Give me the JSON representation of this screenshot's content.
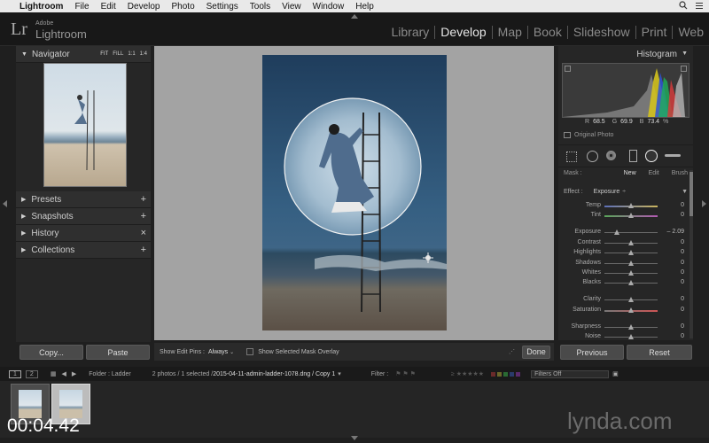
{
  "menubar": {
    "items": [
      "Lightroom",
      "File",
      "Edit",
      "Develop",
      "Photo",
      "Settings",
      "Tools",
      "View",
      "Window",
      "Help"
    ]
  },
  "identity": {
    "adobe": "Adobe",
    "app": "Lightroom",
    "logo": "Lr"
  },
  "modules": [
    "Library",
    "Develop",
    "Map",
    "Book",
    "Slideshow",
    "Print",
    "Web"
  ],
  "navigator": {
    "title": "Navigator",
    "zoom": [
      "FIT",
      "FILL",
      "1:1",
      "1:4"
    ]
  },
  "left_panels": [
    {
      "label": "Presets",
      "action": "+"
    },
    {
      "label": "Snapshots",
      "action": "+"
    },
    {
      "label": "History",
      "action": "×"
    },
    {
      "label": "Collections",
      "action": "+"
    }
  ],
  "left_buttons": {
    "copy": "Copy...",
    "paste": "Paste"
  },
  "toolbar": {
    "edit_pins_label": "Show Edit Pins :",
    "edit_pins_value": "Always",
    "mask_overlay": "Show Selected Mask Overlay",
    "done": "Done"
  },
  "histogram": {
    "title": "Histogram",
    "r_label": "R",
    "r_value": "68.5",
    "g_label": "G",
    "g_value": "69.9",
    "b_label": "B",
    "b_value": "73.4",
    "percent": "%",
    "original": "Original Photo"
  },
  "mask": {
    "label": "Mask :",
    "new": "New",
    "edit": "Edit",
    "brush": "Brush"
  },
  "effect": {
    "label": "Effect :",
    "value": "Exposure"
  },
  "adjustments": [
    {
      "label": "Temp",
      "value": "0",
      "pos": 0.5
    },
    {
      "label": "Tint",
      "value": "0",
      "pos": 0.5
    },
    {
      "label": "Exposure",
      "value": "– 2.09",
      "pos": 0.24
    },
    {
      "label": "Contrast",
      "value": "0",
      "pos": 0.5
    },
    {
      "label": "Highlights",
      "value": "0",
      "pos": 0.5
    },
    {
      "label": "Shadows",
      "value": "0",
      "pos": 0.5
    },
    {
      "label": "Whites",
      "value": "0",
      "pos": 0.5
    },
    {
      "label": "Blacks",
      "value": "0",
      "pos": 0.5
    },
    {
      "label": "Clarity",
      "value": "0",
      "pos": 0.5
    },
    {
      "label": "Saturation",
      "value": "0",
      "pos": 0.5
    },
    {
      "label": "Sharpness",
      "value": "0",
      "pos": 0.5
    },
    {
      "label": "Noise",
      "value": "0",
      "pos": 0.5
    }
  ],
  "right_buttons": {
    "previous": "Previous",
    "reset": "Reset"
  },
  "filmstrip": {
    "view1": "1",
    "view2": "2",
    "folder": "Folder : Ladder",
    "count": "2 photos / 1 selected /",
    "filename": "2015-04-11-admin-ladder-1078.dng / Copy 1",
    "filter_label": "Filter :",
    "filter_value": "Filters Off"
  },
  "overlay": {
    "timecode": "00:04.42",
    "watermark": "lynda.com"
  }
}
